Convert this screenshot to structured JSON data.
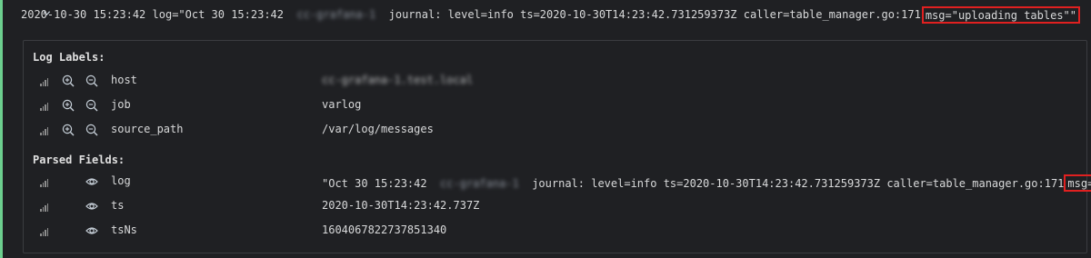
{
  "log_entry": {
    "timestamp": "2020-10-30 15:23:42",
    "prefix": "log=\"Oct 30 15:23:42",
    "host_blurred": "cc-grafana-1",
    "body": "journal: level=info ts=2020-10-30T14:23:42.731259373Z caller=table_manager.go:171",
    "msg_highlight": "msg=\"uploading tables\"\""
  },
  "log_labels": {
    "title": "Log Labels:",
    "items": [
      {
        "label": "host",
        "value": "cc-grafana-1.test.local",
        "blurred": true
      },
      {
        "label": "job",
        "value": "varlog",
        "blurred": false
      },
      {
        "label": "source_path",
        "value": "/var/log/messages",
        "blurred": false
      }
    ]
  },
  "parsed_fields": {
    "title": "Parsed Fields:",
    "items": [
      {
        "label": "log",
        "prefix": "\"Oct 30 15:23:42",
        "host_blurred": "cc-grafana-1",
        "body": "journal: level=info ts=2020-10-30T14:23:42.731259373Z caller=table_manager.go:171",
        "msg_highlight": "msg=\""
      },
      {
        "label": "ts",
        "value": "2020-10-30T14:23:42.737Z"
      },
      {
        "label": "tsNs",
        "value": "1604067822737851340"
      }
    ]
  },
  "colors": {
    "background": "#1f2023",
    "accent_bar": "#6ccf8e",
    "highlight_border": "#e02020"
  }
}
